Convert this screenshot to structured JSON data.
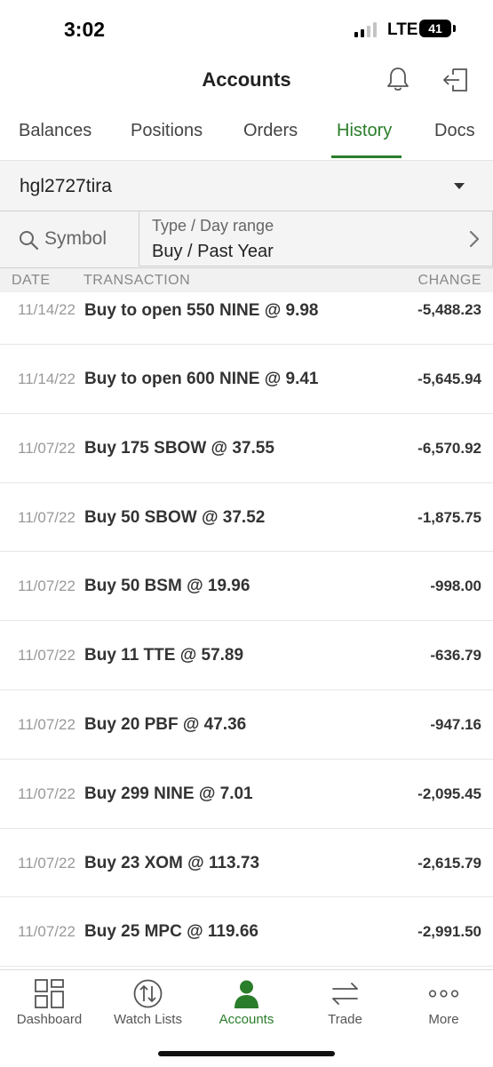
{
  "status_bar": {
    "time": "3:02",
    "network": "LTE",
    "battery": "41"
  },
  "header": {
    "title": "Accounts",
    "bell_icon": "bell-icon",
    "logout_icon": "logout-icon"
  },
  "tabs": [
    {
      "label": "Balances",
      "active": false
    },
    {
      "label": "Positions",
      "active": false
    },
    {
      "label": "Orders",
      "active": false
    },
    {
      "label": "History",
      "active": true
    },
    {
      "label": "Docs",
      "active": false
    }
  ],
  "account_selector": {
    "value": "hgl2727tira"
  },
  "filters": {
    "symbol_label": "Symbol",
    "type_label": "Type / Day range",
    "type_value": "Buy / Past Year"
  },
  "columns": {
    "date": "DATE",
    "transaction": "TRANSACTION",
    "change": "CHANGE"
  },
  "transactions": [
    {
      "date": "11/14/22",
      "description": "Buy to open 550 NINE @ 9.98",
      "change": "-5,488.23"
    },
    {
      "date": "11/14/22",
      "description": "Buy to open 600 NINE @ 9.41",
      "change": "-5,645.94"
    },
    {
      "date": "11/07/22",
      "description": "Buy 175 SBOW @ 37.55",
      "change": "-6,570.92"
    },
    {
      "date": "11/07/22",
      "description": "Buy 50 SBOW @ 37.52",
      "change": "-1,875.75"
    },
    {
      "date": "11/07/22",
      "description": "Buy 50 BSM @ 19.96",
      "change": "-998.00"
    },
    {
      "date": "11/07/22",
      "description": "Buy 11 TTE @ 57.89",
      "change": "-636.79"
    },
    {
      "date": "11/07/22",
      "description": "Buy 20 PBF @ 47.36",
      "change": "-947.16"
    },
    {
      "date": "11/07/22",
      "description": "Buy 299 NINE @ 7.01",
      "change": "-2,095.45"
    },
    {
      "date": "11/07/22",
      "description": "Buy 23 XOM @ 113.73",
      "change": "-2,615.79"
    },
    {
      "date": "11/07/22",
      "description": "Buy 25 MPC @ 119.66",
      "change": "-2,991.50"
    }
  ],
  "bottom_nav": [
    {
      "label": "Dashboard",
      "icon": "dashboard-icon",
      "active": false
    },
    {
      "label": "Watch Lists",
      "icon": "watch-lists-icon",
      "active": false
    },
    {
      "label": "Accounts",
      "icon": "accounts-icon",
      "active": true
    },
    {
      "label": "Trade",
      "icon": "trade-icon",
      "active": false
    },
    {
      "label": "More",
      "icon": "more-icon",
      "active": false
    }
  ],
  "colors": {
    "accent": "#2a7d2a",
    "text": "#222222",
    "muted": "#999999"
  }
}
